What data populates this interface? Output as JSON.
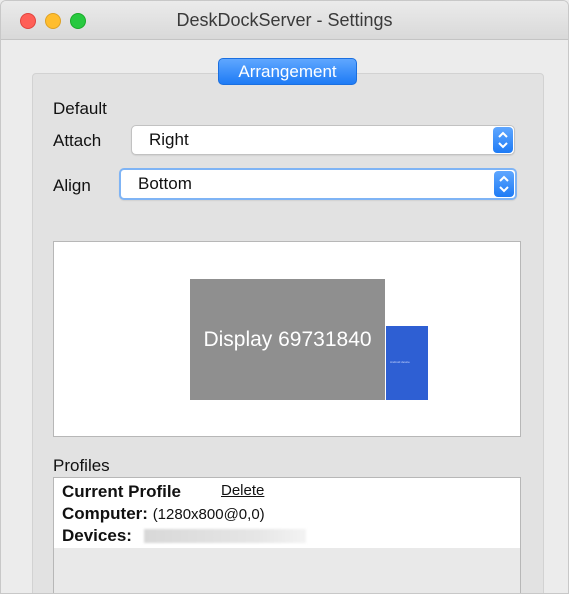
{
  "window": {
    "title": "DeskDockServer - Settings"
  },
  "tabs": {
    "active": "Arrangement"
  },
  "default_section": {
    "title": "Default",
    "attach": {
      "label": "Attach",
      "value": "Right"
    },
    "align": {
      "label": "Align",
      "value": "Bottom"
    }
  },
  "preview": {
    "main_display_label": "Display 69731840",
    "device_label": "Android device"
  },
  "profiles": {
    "title": "Profiles",
    "current_profile_label": "Current Profile",
    "delete_label": "Delete",
    "computer_label": "Computer:",
    "computer_value": "(1280x800@0,0)",
    "devices_label": "Devices:"
  },
  "colors": {
    "accent": "#1e7bf5",
    "main_display": "#8f8f8f",
    "device": "#2e5fd3"
  }
}
